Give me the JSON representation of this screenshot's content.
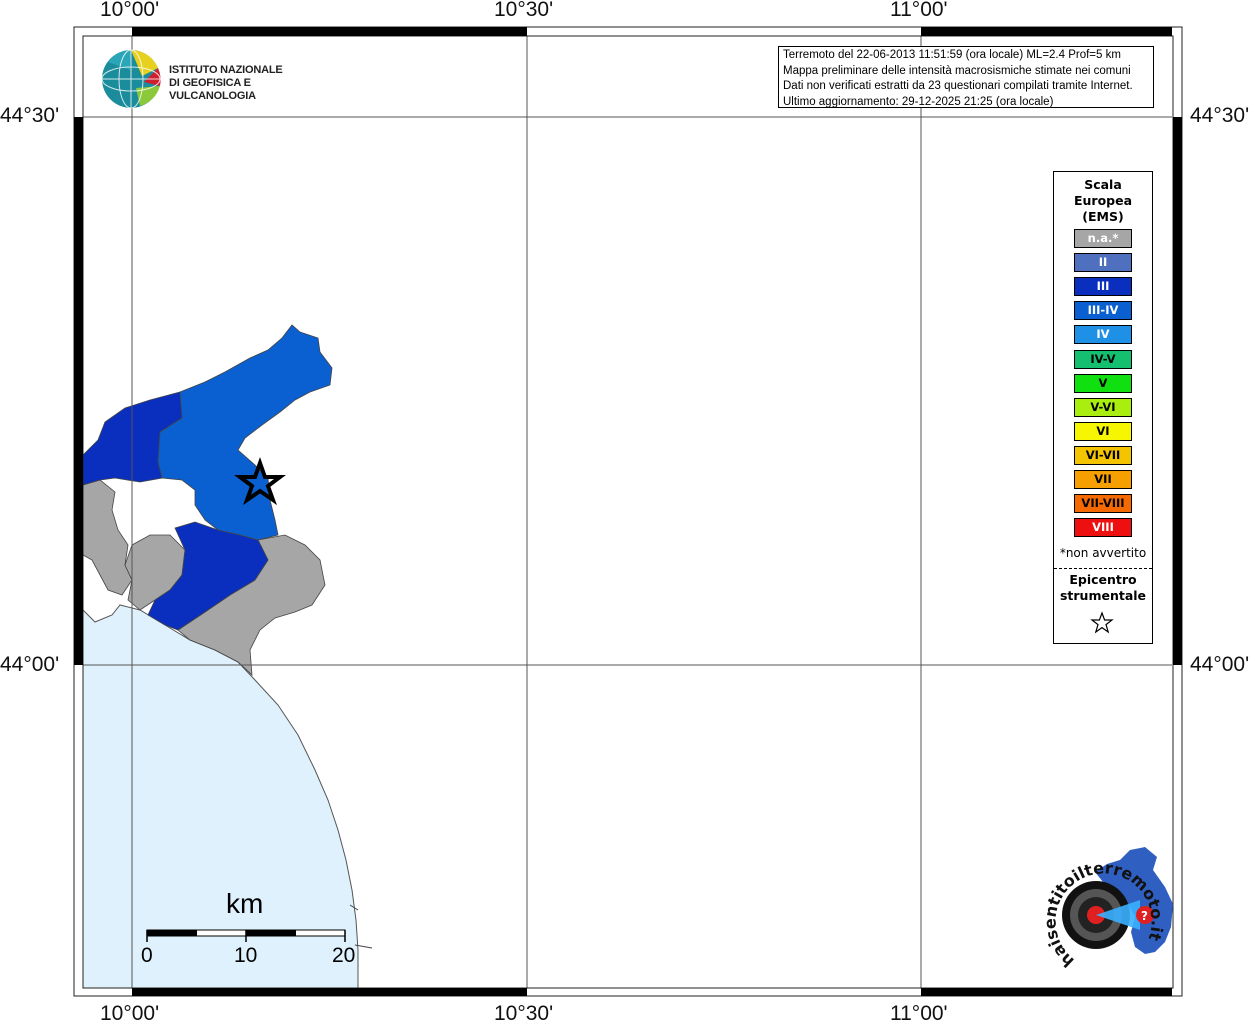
{
  "map": {
    "lon_ticks": [
      "10°00'",
      "10°30'",
      "11°00'"
    ],
    "lat_ticks": [
      "44°30'",
      "44°00'"
    ]
  },
  "info_box": {
    "lines": [
      "Terremoto del 22-06-2013 11:51:59 (ora locale) ML=2.4 Prof=5 km",
      "Mappa preliminare delle intensità macrosismiche stimate nei comuni",
      "Dati non verificati estratti da 23 questionari compilati tramite Internet.",
      "Ultimo aggiornamento: 29-12-2025 21:25 (ora locale)"
    ]
  },
  "logo": {
    "line1": "ISTITUTO NAZIONALE",
    "line2": "DI GEOFISICA E VULCANOLOGIA"
  },
  "legend": {
    "title_lines": [
      "Scala",
      "Europea",
      "(EMS)"
    ],
    "classes": [
      {
        "label": "n.a.*",
        "color": "#a6a6a6",
        "text_color": "#ffffff"
      },
      {
        "label": "II",
        "color": "#4f6fbf",
        "text_color": "#ffffff"
      },
      {
        "label": "III",
        "color": "#0a2fbf",
        "text_color": "#ffffff"
      },
      {
        "label": "III-IV",
        "color": "#0a60d0",
        "text_color": "#ffffff"
      },
      {
        "label": "IV",
        "color": "#1e90e6",
        "text_color": "#ffffff"
      },
      {
        "label": "IV-V",
        "color": "#14c070",
        "text_color": "#000000"
      },
      {
        "label": "V",
        "color": "#10e010",
        "text_color": "#000000"
      },
      {
        "label": "V-VI",
        "color": "#aaee10",
        "text_color": "#000000"
      },
      {
        "label": "VI",
        "color": "#f6f600",
        "text_color": "#000000"
      },
      {
        "label": "VI-VII",
        "color": "#f5c400",
        "text_color": "#000000"
      },
      {
        "label": "VII",
        "color": "#f5a000",
        "text_color": "#000000"
      },
      {
        "label": "VII-VIII",
        "color": "#f56a00",
        "text_color": "#000000"
      },
      {
        "label": "VIII",
        "color": "#ee1010",
        "text_color": "#ffffff"
      }
    ],
    "note": "*non avvertito",
    "epicenter_lines": [
      "Epicentro",
      "strumentale"
    ]
  },
  "scale_bar": {
    "unit": "km",
    "ticks": [
      "0",
      "10",
      "20"
    ]
  },
  "watermark": {
    "text": "haisentitoilterremoto.it"
  },
  "colors": {
    "sea": "#dff1fc",
    "gray_region": "#a6a6a6",
    "iii_region": "#0a2fbf",
    "iii_iv_region": "#0a60d0"
  }
}
